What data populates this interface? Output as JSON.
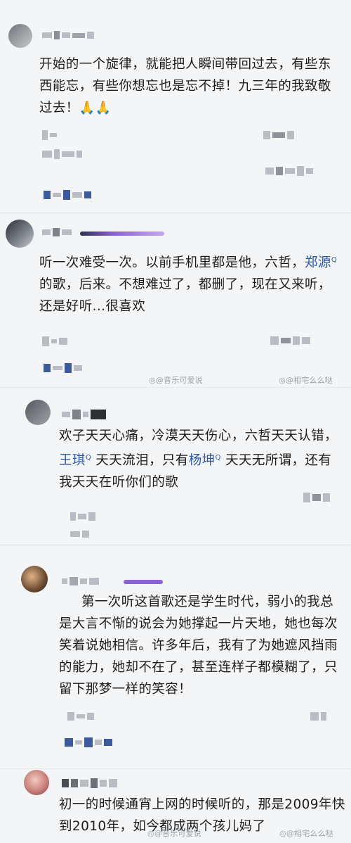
{
  "comments": [
    {
      "text": "开始的一个旋律，就能把人瞬间带回过去，有些东西能忘，有些你想忘也是忘不掉！九三年的我致敬过去！",
      "emoji": "🙏🙏"
    },
    {
      "text_a": "听一次难受一次。以前手机里都是他，六哲，",
      "link1": "郑源",
      "text_b": "的歌，后来。不想难过了，都删了，现在又来听，还是好听...很喜欢"
    },
    {
      "text_a": "欢子天天心痛，冷漠天天伤心，六哲天天认错，",
      "link1": "王琪",
      "text_b": "天天流泪，只有",
      "link2": "杨坤",
      "text_c": "天天无所谓，还有我天天在听你们的歌"
    },
    {
      "text": "第一次听这首歌还是学生时代，弱小的我总是大言不惭的说会为她撑起一片天地，她也每次笑着说她相信。许多年后，我有了为她遮风挡雨的能力，她却不在了，甚至连样子都模糊了，只留下那梦一样的笑容！"
    },
    {
      "text": "初一的时候通宵上网的时候听的，那是2009年快到2010年，如今都成两个孩儿妈了"
    }
  ],
  "link_marker": "Q",
  "watermarks": {
    "left": "@音乐可爱说",
    "right": "@相宅么么哒"
  },
  "colors": {
    "background": "#f4f5f7",
    "text": "#1d1d1d",
    "link": "#2c5aa8",
    "badge_purple": "#8a63d2"
  }
}
